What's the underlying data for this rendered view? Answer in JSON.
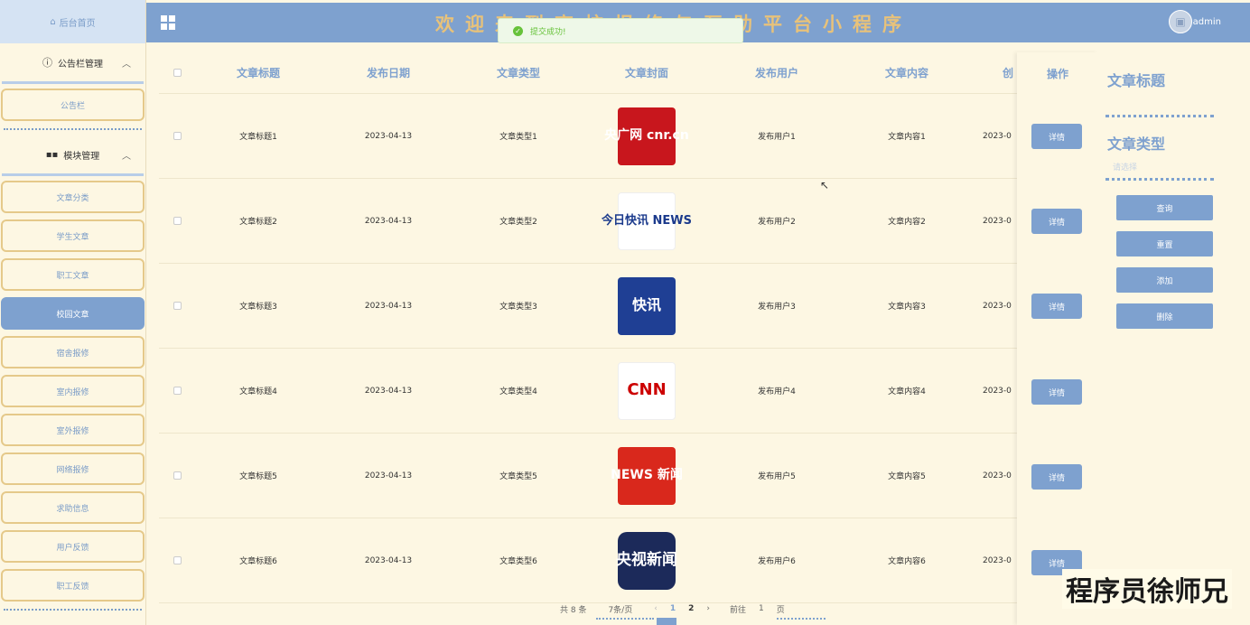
{
  "sidebar": {
    "home_label": "后台首页",
    "groups": [
      {
        "label": "公告栏管理",
        "items": [
          {
            "label": "公告栏"
          }
        ]
      },
      {
        "label": "模块管理",
        "items": [
          {
            "label": "文章分类"
          },
          {
            "label": "学生文章"
          },
          {
            "label": "职工文章"
          },
          {
            "label": "校园文章"
          },
          {
            "label": "宿舍报修"
          },
          {
            "label": "室内报修"
          },
          {
            "label": "室外报修"
          },
          {
            "label": "网络报修"
          },
          {
            "label": "求助信息"
          },
          {
            "label": "用户反馈"
          },
          {
            "label": "职工反馈"
          }
        ]
      }
    ],
    "active_item": "校园文章"
  },
  "header": {
    "title": "欢迎来到高校报修与互助平台小程序",
    "user": "admin"
  },
  "toast": {
    "message": "提交成功!"
  },
  "table": {
    "columns": [
      "文章标题",
      "发布日期",
      "文章类型",
      "文章封面",
      "发布用户",
      "文章内容",
      "创",
      "操作"
    ],
    "rows": [
      {
        "title": "文章标题1",
        "date": "2023-04-13",
        "type": "文章类型1",
        "cover": "央广网 cnr.cn",
        "user": "发布用户1",
        "content": "文章内容1",
        "created": "2023-0",
        "action": "详情"
      },
      {
        "title": "文章标题2",
        "date": "2023-04-13",
        "type": "文章类型2",
        "cover": "今日快讯 NEWS",
        "user": "发布用户2",
        "content": "文章内容2",
        "created": "2023-0",
        "action": "详情"
      },
      {
        "title": "文章标题3",
        "date": "2023-04-13",
        "type": "文章类型3",
        "cover": "快讯",
        "user": "发布用户3",
        "content": "文章内容3",
        "created": "2023-0",
        "action": "详情"
      },
      {
        "title": "文章标题4",
        "date": "2023-04-13",
        "type": "文章类型4",
        "cover": "CNN",
        "user": "发布用户4",
        "content": "文章内容4",
        "created": "2023-0",
        "action": "详情"
      },
      {
        "title": "文章标题5",
        "date": "2023-04-13",
        "type": "文章类型5",
        "cover": "NEWS 新闻",
        "user": "发布用户5",
        "content": "文章内容5",
        "created": "2023-0",
        "action": "详情"
      },
      {
        "title": "文章标题6",
        "date": "2023-04-13",
        "type": "文章类型6",
        "cover": "央视新闻",
        "user": "发布用户6",
        "content": "文章内容6",
        "created": "2023-0",
        "action": "详情"
      }
    ]
  },
  "search_panel": {
    "field1_label": "文章标题",
    "field2_label": "文章类型",
    "field2_placeholder": "请选择",
    "buttons": [
      "查询",
      "重置",
      "添加",
      "删除"
    ]
  },
  "pagination": {
    "total": "共 8 条",
    "page_size": "7条/页",
    "pages": [
      "1",
      "2"
    ],
    "current": "1",
    "goto_label": "前往",
    "goto_value": "1",
    "page_suffix": "页"
  },
  "watermark": "程序员徐师兄",
  "colors": {
    "accent": "#7ea1cf",
    "background": "#fdf7e3",
    "title_gold": "#e8c27a",
    "border_gold": "#e5c98a"
  }
}
